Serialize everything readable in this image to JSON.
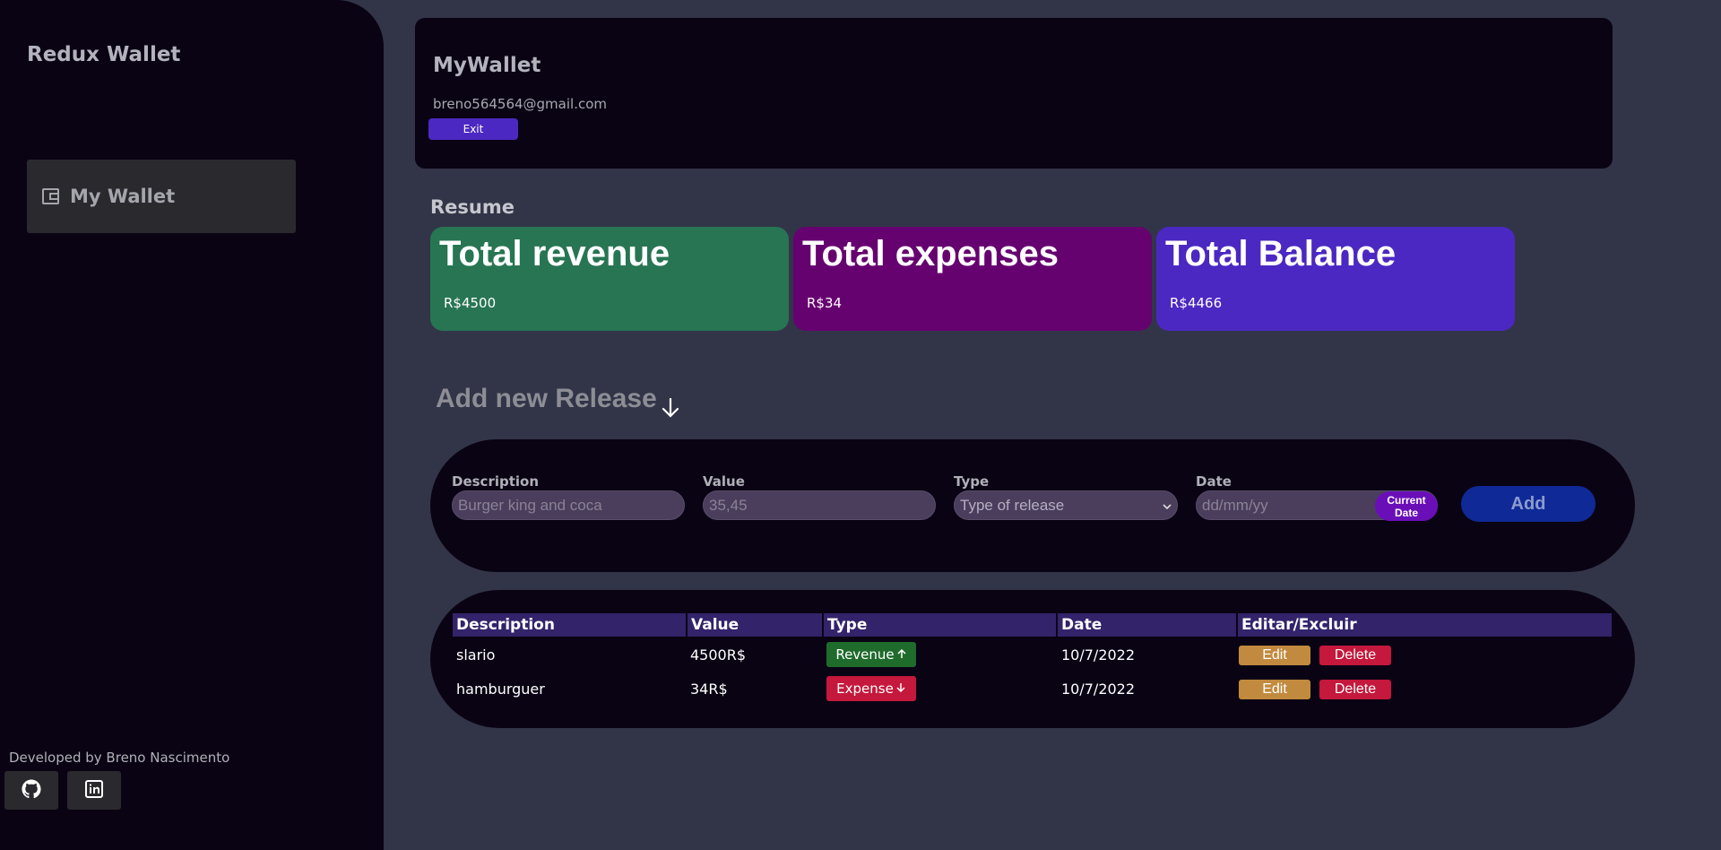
{
  "sidebar": {
    "brand": "Redux Wallet",
    "nav_item": {
      "label": "My Wallet",
      "icon": "wallet-icon"
    },
    "credit": "Developed by Breno Nascimento",
    "social": [
      {
        "icon": "github-icon"
      },
      {
        "icon": "linkedin-icon"
      }
    ]
  },
  "header": {
    "title": "MyWallet",
    "email": "breno564564@gmail.com",
    "exit_label": "Exit"
  },
  "resume": {
    "title": "Resume",
    "cards": [
      {
        "title": "Total revenue",
        "value": "R$4500",
        "color": "#277553"
      },
      {
        "title": "Total expenses",
        "value": "R$34",
        "color": "#660270"
      },
      {
        "title": "Total Balance",
        "value": "R$4466",
        "color": "#4b28c2"
      }
    ]
  },
  "form": {
    "title": "Add new Release",
    "description": {
      "label": "Description",
      "placeholder": "Burger king and coca"
    },
    "value": {
      "label": "Value",
      "placeholder": "35,45"
    },
    "type": {
      "label": "Type",
      "selected": "Type of release"
    },
    "date": {
      "label": "Date",
      "placeholder": "dd/mm/yy"
    },
    "current_date_label": "Current Date",
    "add_label": "Add"
  },
  "table": {
    "headers": [
      "Description",
      "Value",
      "Type",
      "Date",
      "Editar/Excluir"
    ],
    "rows": [
      {
        "description": "slario",
        "value": "4500R$",
        "type": "Revenue",
        "type_color": "#1f6b2c",
        "date": "10/7/2022"
      },
      {
        "description": "hamburguer",
        "value": "34R$",
        "type": "Expense",
        "type_color": "#c4183c",
        "date": "10/7/2022"
      }
    ],
    "edit_label": "Edit",
    "delete_label": "Delete",
    "edit_color": "#c28a3e",
    "delete_color": "#c4183c"
  }
}
